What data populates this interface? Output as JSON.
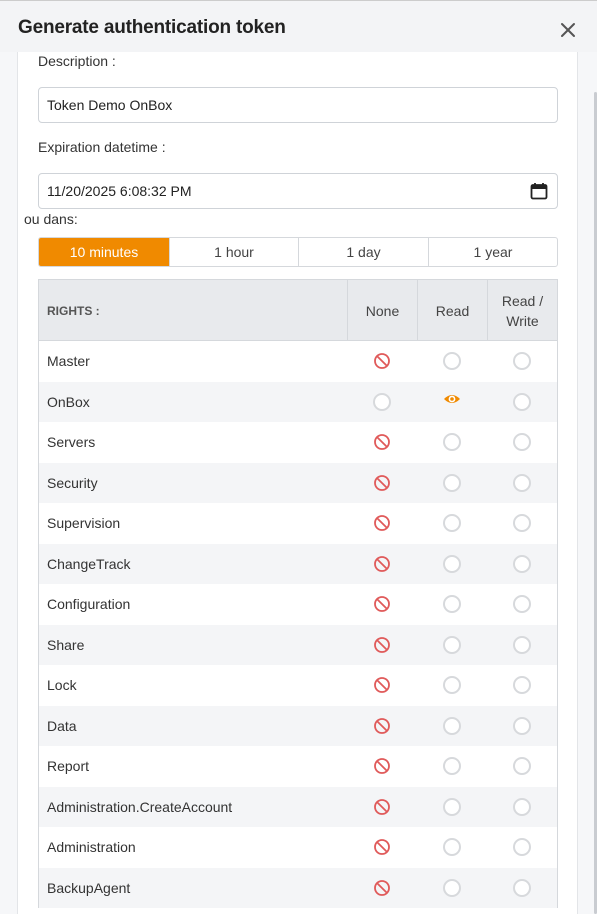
{
  "dialog": {
    "title": "Generate authentication token"
  },
  "form": {
    "description_label": "Description :",
    "description_value": "Token Demo OnBox",
    "expiration_label": "Expiration datetime :",
    "expiration_value": "11/20/2025 6:08:32 PM",
    "or_in_label": "ou dans:"
  },
  "durations": [
    {
      "label": "10 minutes",
      "active": true
    },
    {
      "label": "1 hour",
      "active": false
    },
    {
      "label": "1 day",
      "active": false
    },
    {
      "label": "1 year",
      "active": false
    }
  ],
  "table": {
    "headers": {
      "rights": "RIGHTS :",
      "none": "None",
      "read": "Read",
      "read_write_line1": "Read /",
      "read_write_line2": "Write"
    },
    "rows": [
      {
        "label": "Master",
        "selected": "none"
      },
      {
        "label": "OnBox",
        "selected": "read"
      },
      {
        "label": "Servers",
        "selected": "none"
      },
      {
        "label": "Security",
        "selected": "none"
      },
      {
        "label": "Supervision",
        "selected": "none"
      },
      {
        "label": "ChangeTrack",
        "selected": "none"
      },
      {
        "label": "Configuration",
        "selected": "none"
      },
      {
        "label": "Share",
        "selected": "none"
      },
      {
        "label": "Lock",
        "selected": "none"
      },
      {
        "label": "Data",
        "selected": "none"
      },
      {
        "label": "Report",
        "selected": "none"
      },
      {
        "label": "Administration.CreateAccount",
        "selected": "none"
      },
      {
        "label": "Administration",
        "selected": "none"
      },
      {
        "label": "BackupAgent",
        "selected": "none"
      }
    ]
  },
  "colors": {
    "accent": "#f08a00",
    "none_icon": "#e05a5a",
    "read_icon": "#f08a00"
  },
  "icons": {
    "close": "close-icon",
    "calendar": "calendar-icon",
    "none": "no-entry-icon",
    "read": "eye-icon"
  }
}
